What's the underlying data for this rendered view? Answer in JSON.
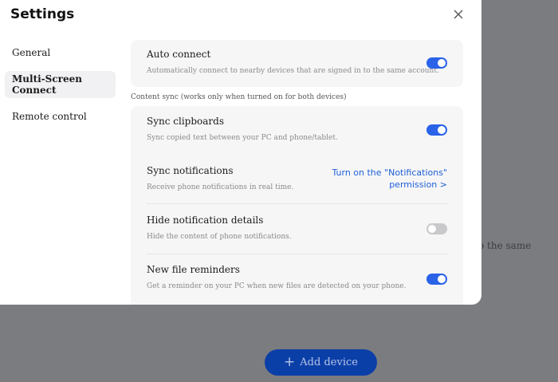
{
  "background": {
    "partial_text": "o the same",
    "add_device_label": "Add device"
  },
  "dialog": {
    "title": "Settings",
    "close_icon": "close-icon"
  },
  "sidebar": {
    "items": [
      {
        "label": "General",
        "active": false
      },
      {
        "label": "Multi-Screen Connect",
        "active": true
      },
      {
        "label": "Remote control",
        "active": false
      }
    ]
  },
  "auto_connect": {
    "title": "Auto connect",
    "description": "Automatically connect to nearby devices that are signed in to the same account.",
    "enabled": true
  },
  "content_sync": {
    "label": "Content sync (works only when turned on for both devices)",
    "items": [
      {
        "title": "Sync clipboards",
        "description": "Sync copied text between your PC and phone/tablet.",
        "enabled": true
      },
      {
        "title": "Sync notifications",
        "description": "Receive phone notifications in real time.",
        "link_line1": "Turn on the \"Notifications\"",
        "link_line2": "permission >"
      },
      {
        "title": "Hide notification details",
        "description": "Hide the content of phone notifications.",
        "enabled": false
      },
      {
        "title": "New file reminders",
        "description": "Get a reminder on your PC when new files are detected on your phone.",
        "enabled": true
      }
    ]
  },
  "colors": {
    "accent": "#2a63e8",
    "link": "#1d5fd6",
    "toggle_off": "#c9c9cc",
    "overlay": "#7b7c80"
  }
}
